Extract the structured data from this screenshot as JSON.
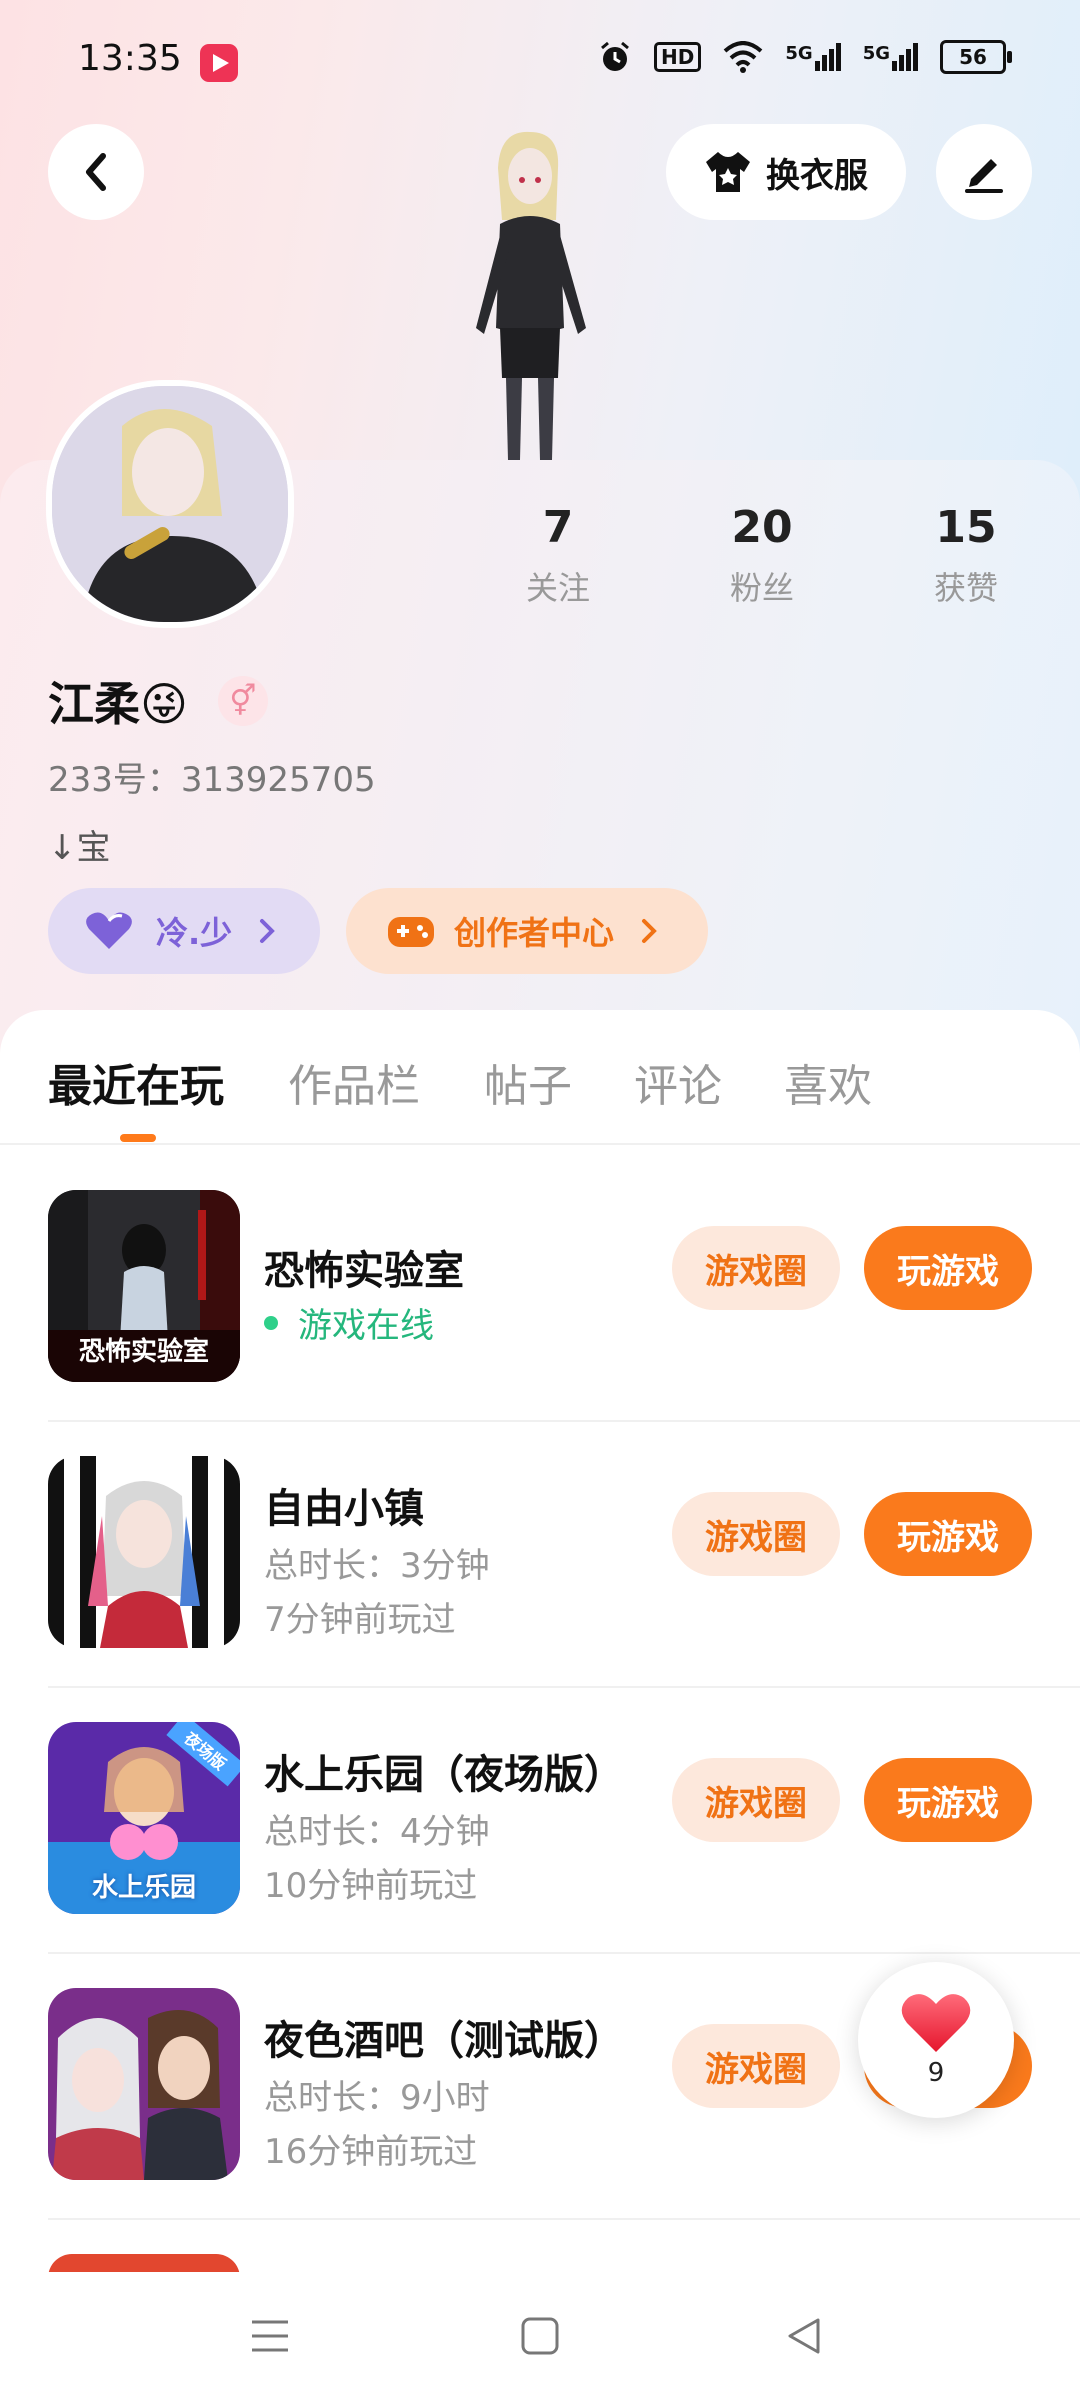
{
  "status_bar": {
    "time": "13:35",
    "net_hd": "HD",
    "sim1": "5G",
    "sim2": "5G",
    "battery": "56"
  },
  "header": {
    "change_outfit_label": "换衣服"
  },
  "profile": {
    "nickname": "江柔😜",
    "gender_symbol": "⚥",
    "account_id": "233号：313925705",
    "signature": "↓宝",
    "stats": [
      {
        "value": "7",
        "label": "关注"
      },
      {
        "value": "20",
        "label": "粉丝"
      },
      {
        "value": "15",
        "label": "获赞"
      }
    ],
    "chips": {
      "group_label": "冷.少",
      "creator_label": "创作者中心"
    }
  },
  "tabs": [
    "最近在玩",
    "作品栏",
    "帖子",
    "评论",
    "喜欢"
  ],
  "games": [
    {
      "title": "恐怖实验室",
      "status": "游戏在线",
      "icon_text": "恐怖实验室"
    },
    {
      "title": "自由小镇",
      "duration": "总时长：3分钟",
      "last_played": "7分钟前玩过"
    },
    {
      "title": "水上乐园（夜场版）",
      "duration": "总时长：4分钟",
      "last_played": "10分钟前玩过",
      "icon_text": "水上乐园",
      "icon_badge": "夜场版"
    },
    {
      "title": "夜色酒吧（测试版）",
      "duration": "总时长：9小时",
      "last_played": "16分钟前玩过"
    }
  ],
  "buttons": {
    "circle": "游戏圈",
    "play": "玩游戏"
  },
  "floating_like": {
    "count": "9"
  },
  "colors": {
    "accent": "#fa7a1c",
    "online": "#25b77d",
    "purple": "#7d62d8"
  }
}
